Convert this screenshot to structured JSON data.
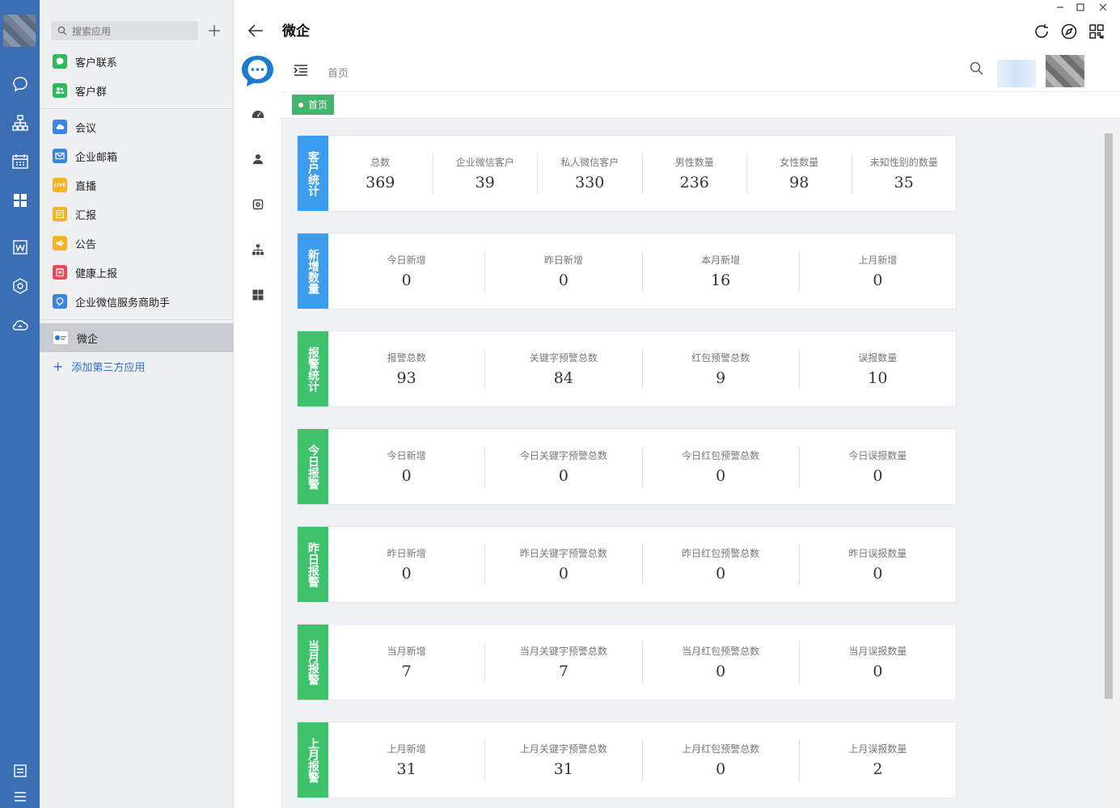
{
  "apps_panel": {
    "search_placeholder": "搜索应用",
    "items": [
      {
        "label": "客户联系",
        "color": "#2dba5c"
      },
      {
        "label": "客户群",
        "color": "#2dba5c"
      },
      {
        "label": "会议",
        "color": "#3c84e0"
      },
      {
        "label": "企业邮箱",
        "color": "#3c84e0"
      },
      {
        "label": "直播",
        "color": "#f5b221",
        "glyph": "LIVE"
      },
      {
        "label": "汇报",
        "color": "#f5b221"
      },
      {
        "label": "公告",
        "color": "#f5b221"
      },
      {
        "label": "健康上报",
        "color": "#e74a58"
      },
      {
        "label": "企业微信服务商助手",
        "color": "#3c84e0"
      },
      {
        "label": "微企",
        "color": "#ffffff"
      }
    ],
    "add_third_party": "添加第三方应用"
  },
  "header": {
    "title": "微企"
  },
  "nav": {
    "breadcrumb": "首页",
    "tag": "首页"
  },
  "cards": [
    {
      "title": "客户统计",
      "color": "blue",
      "stats": [
        {
          "label": "总数",
          "value": "369"
        },
        {
          "label": "企业微信客户",
          "value": "39"
        },
        {
          "label": "私人微信客户",
          "value": "330"
        },
        {
          "label": "男性数量",
          "value": "236"
        },
        {
          "label": "女性数量",
          "value": "98"
        },
        {
          "label": "未知性别的数量",
          "value": "35"
        }
      ]
    },
    {
      "title": "新增数量",
      "color": "blue",
      "stats": [
        {
          "label": "今日新增",
          "value": "0"
        },
        {
          "label": "昨日新增",
          "value": "0"
        },
        {
          "label": "本月新增",
          "value": "16"
        },
        {
          "label": "上月新增",
          "value": "0"
        }
      ]
    },
    {
      "title": "报警统计",
      "color": "green",
      "stats": [
        {
          "label": "报警总数",
          "value": "93"
        },
        {
          "label": "关键字预警总数",
          "value": "84"
        },
        {
          "label": "红包预警总数",
          "value": "9"
        },
        {
          "label": "误报数量",
          "value": "10"
        }
      ]
    },
    {
      "title": "今日报警",
      "color": "green",
      "stats": [
        {
          "label": "今日新增",
          "value": "0"
        },
        {
          "label": "今日关键字预警总数",
          "value": "0"
        },
        {
          "label": "今日红包预警总数",
          "value": "0"
        },
        {
          "label": "今日误报数量",
          "value": "0"
        }
      ]
    },
    {
      "title": "昨日报警",
      "color": "green",
      "stats": [
        {
          "label": "昨日新增",
          "value": "0"
        },
        {
          "label": "昨日关键字预警总数",
          "value": "0"
        },
        {
          "label": "昨日红包预警总数",
          "value": "0"
        },
        {
          "label": "昨日误报数量",
          "value": "0"
        }
      ]
    },
    {
      "title": "当月报警",
      "color": "green",
      "stats": [
        {
          "label": "当月新增",
          "value": "7"
        },
        {
          "label": "当月关键字预警总数",
          "value": "7"
        },
        {
          "label": "当月红包预警总数",
          "value": "0"
        },
        {
          "label": "当月误报数量",
          "value": "0"
        }
      ]
    },
    {
      "title": "上月报警",
      "color": "green",
      "stats": [
        {
          "label": "上月新增",
          "value": "31"
        },
        {
          "label": "上月关键字预警总数",
          "value": "31"
        },
        {
          "label": "上月红包预警总数",
          "value": "0"
        },
        {
          "label": "上月误报数量",
          "value": "2"
        }
      ]
    }
  ]
}
